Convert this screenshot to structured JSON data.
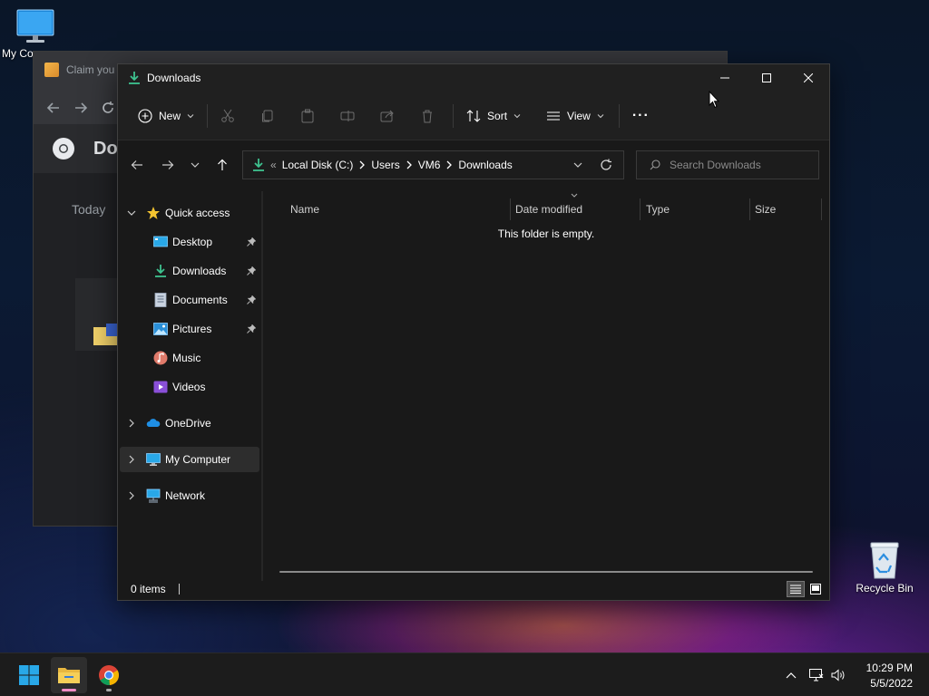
{
  "desktop": {
    "icons": [
      {
        "label": "My Co",
        "icon": "monitor-icon"
      },
      {
        "label": "Recycle Bin",
        "icon": "recycle-bin-icon"
      }
    ]
  },
  "chrome_window": {
    "tab_title": "Claim you",
    "page_title": "Do",
    "section_label": "Today"
  },
  "explorer": {
    "title": "Downloads",
    "toolbar": {
      "new_label": "New",
      "sort_label": "Sort",
      "view_label": "View",
      "more_label": "···"
    },
    "breadcrumb": {
      "overflow": "«",
      "items": [
        "Local Disk (C:)",
        "Users",
        "VM6",
        "Downloads"
      ]
    },
    "search": {
      "placeholder": "Search Downloads"
    },
    "nav": {
      "quick_access": "Quick access",
      "items": [
        {
          "label": "Desktop",
          "icon": "desktop-folder-icon",
          "pinned": true
        },
        {
          "label": "Downloads",
          "icon": "downloads-folder-icon",
          "pinned": true
        },
        {
          "label": "Documents",
          "icon": "documents-folder-icon",
          "pinned": true
        },
        {
          "label": "Pictures",
          "icon": "pictures-folder-icon",
          "pinned": true
        },
        {
          "label": "Music",
          "icon": "music-folder-icon",
          "pinned": false
        },
        {
          "label": "Videos",
          "icon": "videos-folder-icon",
          "pinned": false
        }
      ],
      "onedrive": "OneDrive",
      "my_computer": "My Computer",
      "network": "Network"
    },
    "columns": [
      "Name",
      "Date modified",
      "Type",
      "Size"
    ],
    "empty_message": "This folder is empty.",
    "status": {
      "items_count": "0 items"
    }
  },
  "taskbar": {
    "time": "10:29 PM",
    "date": "5/5/2022"
  },
  "colors": {
    "accent_download": "#3ec28f",
    "win_blue": "#29a8e8",
    "taskbar_bg": "#1c1c1c"
  }
}
